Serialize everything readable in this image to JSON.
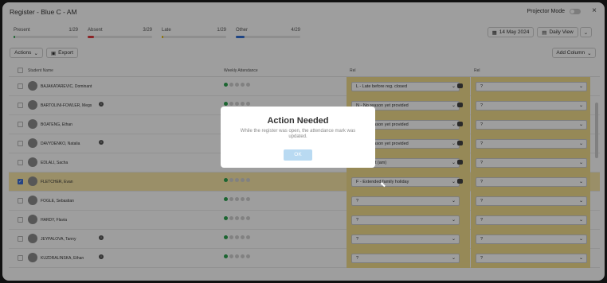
{
  "title": "Register - Blue C - AM",
  "projector_mode_label": "Projector Mode",
  "close_icon": "×",
  "stats": [
    {
      "label": "Present",
      "value": "1/29",
      "fill_fraction": 0.03,
      "color": "#2ea44f"
    },
    {
      "label": "Absent",
      "value": "3/29",
      "fill_fraction": 0.1,
      "color": "#e0393e"
    },
    {
      "label": "Late",
      "value": "1/29",
      "fill_fraction": 0.03,
      "color": "#e6b800"
    },
    {
      "label": "Other",
      "value": "4/29",
      "fill_fraction": 0.14,
      "color": "#2f6fd6"
    }
  ],
  "date_label": "14 May 2024",
  "view_label": "Daily View",
  "actions_label": "Actions",
  "export_label": "Export",
  "add_column_label": "Add Column",
  "columns": {
    "student": "Student Name",
    "weekly": "Weekly Attendance",
    "col1": "Rel",
    "col2": "Rel"
  },
  "rows": [
    {
      "name": "BAJAKATAREVIC, Dominant",
      "info": false,
      "col1": "L - Late before reg. closed",
      "col2": "?",
      "selected": false,
      "comment": true
    },
    {
      "name": "BARTOLINI-FOWLER, Megs",
      "info": true,
      "col1": "N - No reason yet provided",
      "col2": "?",
      "selected": false,
      "comment": true
    },
    {
      "name": "BOATENG, Ethan",
      "info": false,
      "col1": "N - No reason yet provided",
      "col2": "?",
      "selected": false,
      "comment": true
    },
    {
      "name": "DAVYDENKO, Natalia",
      "info": true,
      "col1": "N - No reason yet provided",
      "col2": "?",
      "selected": false,
      "comment": true
    },
    {
      "name": "EDLALI, Sacha",
      "info": false,
      "col1": "/ - Present (am)",
      "col2": "?",
      "selected": false,
      "comment": true
    },
    {
      "name": "FLETCHER, Evan",
      "info": false,
      "col1": "F - Extended family holiday",
      "col2": "?",
      "selected": true,
      "comment": true
    },
    {
      "name": "FOGLE, Sebastian",
      "info": false,
      "col1": "?",
      "col2": "?",
      "selected": false,
      "comment": false
    },
    {
      "name": "HARDY, Flavia",
      "info": false,
      "col1": "?",
      "col2": "?",
      "selected": false,
      "comment": false
    },
    {
      "name": "JEYPALOVA, Tanny",
      "info": true,
      "col1": "?",
      "col2": "?",
      "selected": false,
      "comment": false
    },
    {
      "name": "KUZDRALINSKA, Ethan",
      "info": true,
      "col1": "?",
      "col2": "?",
      "selected": false,
      "comment": false
    }
  ],
  "modal": {
    "title": "Action Needed",
    "message": "While the register was open, the attendance mark was updated.",
    "ok_label": "OK"
  },
  "icons": {
    "calendar": "calendar-icon",
    "chevron": "chevron-down-icon",
    "export": "export-icon",
    "comment": "comment-icon",
    "info": "info-icon",
    "avatar": "avatar"
  }
}
